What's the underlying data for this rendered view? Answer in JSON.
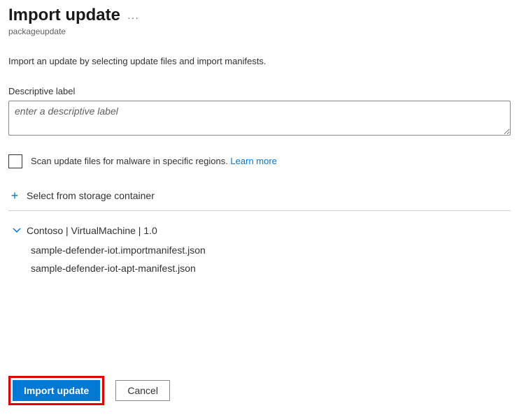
{
  "header": {
    "title": "Import update",
    "subtitle": "packageupdate",
    "description": "Import an update by selecting update files and import manifests."
  },
  "form": {
    "descriptive_label": "Descriptive label",
    "descriptive_placeholder": "enter a descriptive label",
    "scan_checkbox_label": "Scan update files for malware in specific regions. ",
    "learn_more": "Learn more",
    "select_storage_label": "Select from storage container"
  },
  "update_item": {
    "label": "Contoso | VirtualMachine | 1.0",
    "files": [
      "sample-defender-iot.importmanifest.json",
      "sample-defender-iot-apt-manifest.json"
    ]
  },
  "footer": {
    "import_btn": "Import update",
    "cancel_btn": "Cancel"
  }
}
